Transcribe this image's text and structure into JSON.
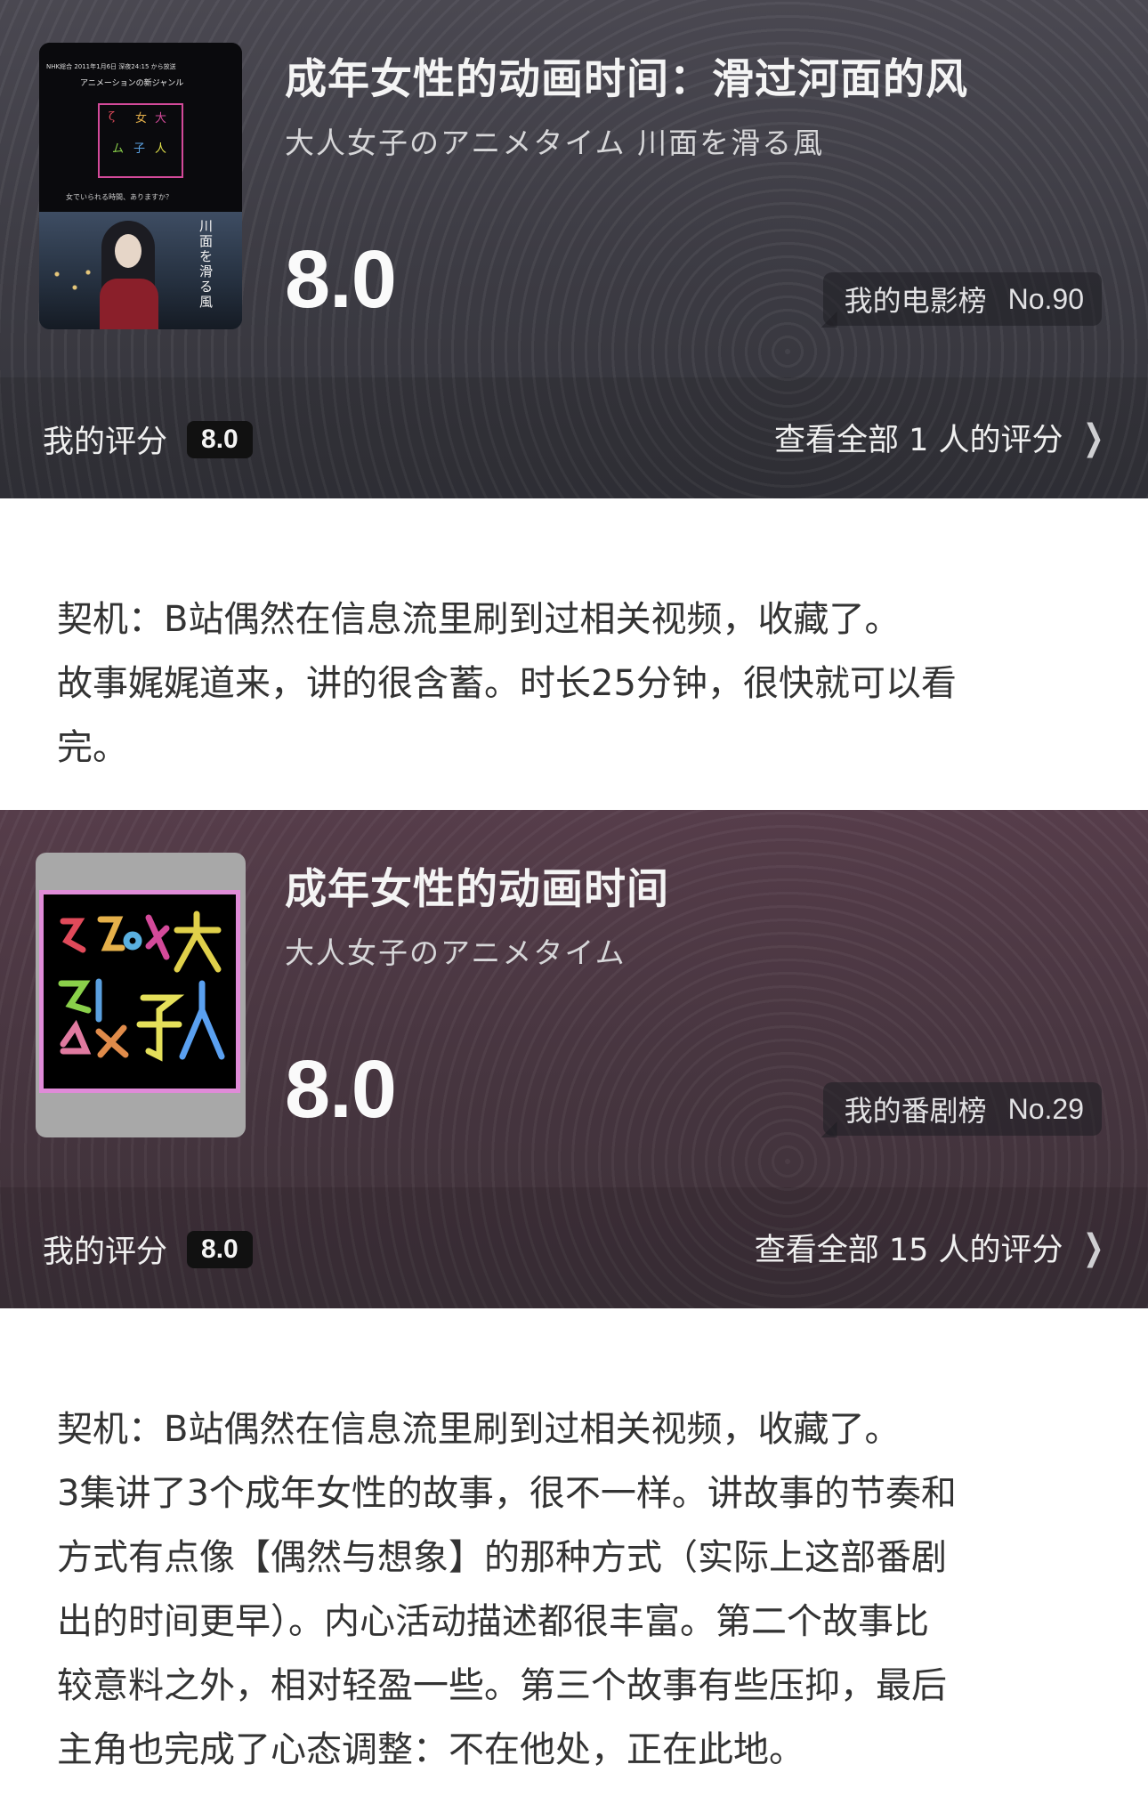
{
  "cards": [
    {
      "title": "成年女性的动画时间：滑过河面的风",
      "subtitle": "大人女子のアニメタイム 川面を滑る風",
      "score": "8.0",
      "rank_label": "我的电影榜",
      "rank_no": "No.90",
      "my_rating_label": "我的评分",
      "my_rating": "8.0",
      "all_ratings": "查看全部 1 人的评分",
      "poster": {
        "top_text": "NHK総合 2011年1月6日 深夜24:15 から放送",
        "genre": "アニメーションの新ジャンル",
        "tagline": "女でいられる時間、ありますか？",
        "vertical_title": "川面を滑る風"
      }
    },
    {
      "title": "成年女性的动画时间",
      "subtitle": "大人女子のアニメタイム",
      "score": "8.0",
      "rank_label": "我的番剧榜",
      "rank_no": "No.29",
      "my_rating_label": "我的评分",
      "my_rating": "8.0",
      "all_ratings": "查看全部 15 人的评分"
    }
  ],
  "reviews": [
    [
      "契机：B站偶然在信息流里刷到过相关视频，收藏了。",
      "故事娓娓道来，讲的很含蓄。时长25分钟，很快就可以看",
      "完。"
    ],
    [
      "契机：B站偶然在信息流里刷到过相关视频，收藏了。",
      "3集讲了3个成年女性的故事，很不一样。讲故事的节奏和",
      "方式有点像【偶然与想象】的那种方式（实际上这部番剧",
      "出的时间更早）。内心活动描述都很丰富。第二个故事比",
      "较意料之外，相对轻盈一些。第三个故事有些压抑，最后",
      "主角也完成了心态调整：不在他处，正在此地。"
    ]
  ],
  "colors": {
    "card1": "#3c3b43",
    "card2": "#46353f",
    "logo_pink": "#e08bd8"
  },
  "icons": {
    "chevron": "chevron-right-icon"
  }
}
